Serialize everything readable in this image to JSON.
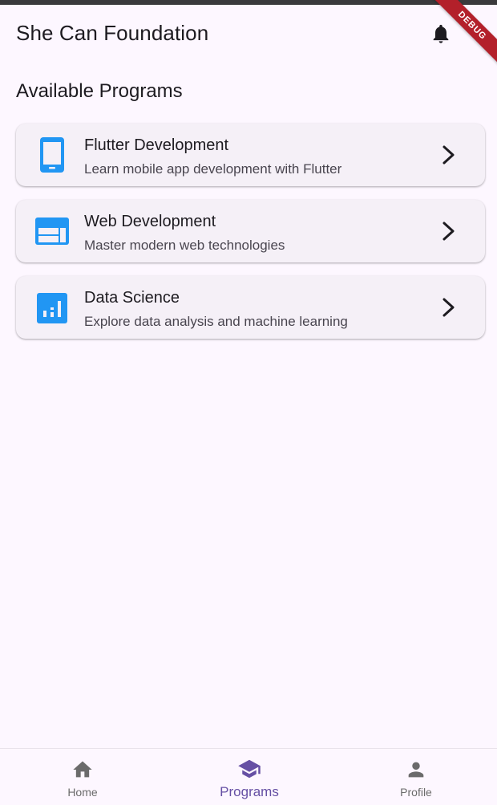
{
  "app_bar": {
    "title": "She Can Foundation",
    "notification_icon": "bell-icon",
    "debug_banner": "DEBUG"
  },
  "section": {
    "title": "Available Programs"
  },
  "programs": [
    {
      "title": "Flutter Development",
      "subtitle": "Learn mobile app development with Flutter",
      "icon": "phone-android-icon",
      "icon_color": "#2196f3"
    },
    {
      "title": "Web Development",
      "subtitle": "Master modern web technologies",
      "icon": "web-icon",
      "icon_color": "#2196f3"
    },
    {
      "title": "Data Science",
      "subtitle": "Explore data analysis and machine learning",
      "icon": "analytics-icon",
      "icon_color": "#2196f3"
    }
  ],
  "bottom_nav": {
    "items": [
      {
        "label": "Home",
        "icon": "home-icon",
        "active": false
      },
      {
        "label": "Programs",
        "icon": "school-icon",
        "active": true
      },
      {
        "label": "Profile",
        "icon": "person-icon",
        "active": false
      }
    ],
    "active_color": "#6650a4",
    "inactive_color": "#6b6b6b"
  }
}
